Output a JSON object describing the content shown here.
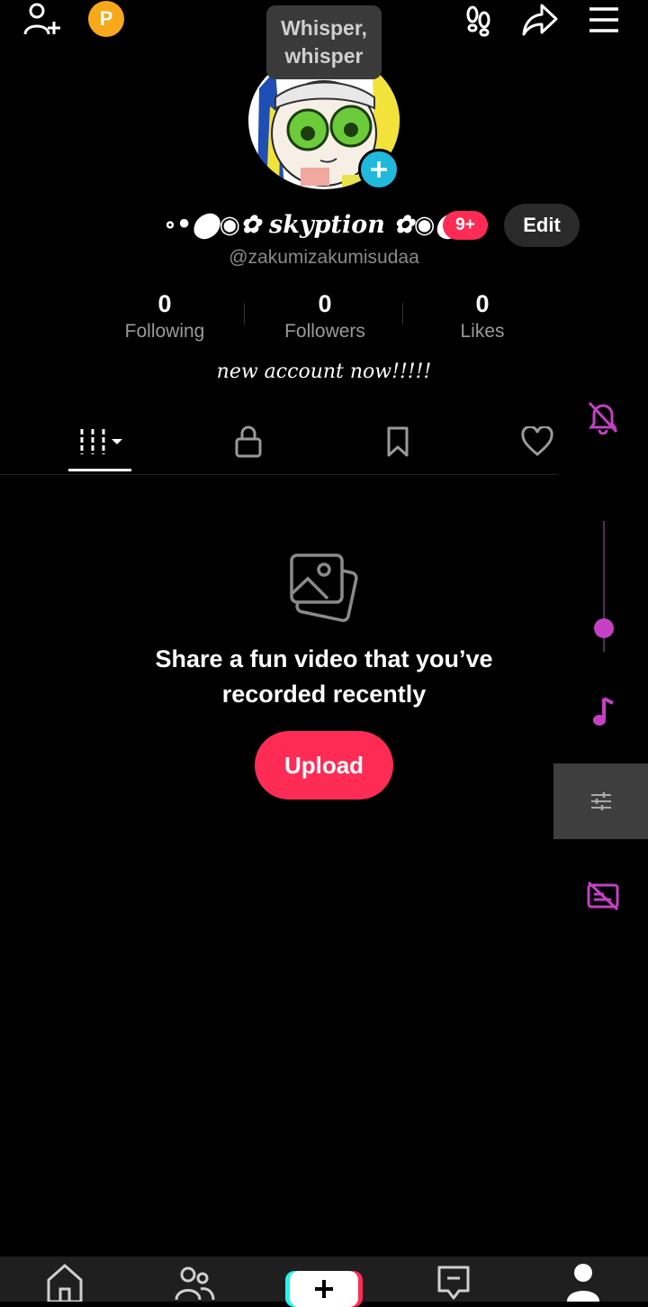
{
  "header": {
    "add_friend_icon": "person-plus-icon",
    "coin_label": "P",
    "footprint_icon": "footprints-icon",
    "share_icon": "share-icon",
    "menu_icon": "hamburger-menu-icon"
  },
  "tooltip": {
    "line1": "Whisper,",
    "line2": "whisper"
  },
  "profile": {
    "display_name": "∘•⬤◉✿ skyption ✿◉⬤•∘",
    "notification_badge": "9+",
    "edit_label": "Edit",
    "handle": "@zakumizakumisudaa",
    "bio": "new account now!!!!!"
  },
  "stats": [
    {
      "value": "0",
      "label": "Following"
    },
    {
      "value": "0",
      "label": "Followers"
    },
    {
      "value": "0",
      "label": "Likes"
    }
  ],
  "tabs": [
    {
      "icon": "grid-videos-icon",
      "active": true
    },
    {
      "icon": "lock-icon",
      "active": false
    },
    {
      "icon": "bookmark-icon",
      "active": false
    },
    {
      "icon": "heart-icon",
      "active": false
    }
  ],
  "empty_state": {
    "line1": "Share a fun video that you’ve",
    "line2": "recorded recently",
    "upload_label": "Upload"
  },
  "overlay_controls": {
    "accent_color": "#c441c4",
    "icons": [
      "bell-off-icon",
      "music-note-icon",
      "sliders-icon",
      "subtitles-off-icon"
    ],
    "slider_level": 0.2
  },
  "bottom_nav": [
    "home-icon",
    "friends-icon",
    "create-plus-icon",
    "inbox-icon",
    "profile-icon"
  ],
  "colors": {
    "brand_red": "#fe2c55",
    "brand_cyan": "#25f4ee",
    "background": "#000000"
  }
}
